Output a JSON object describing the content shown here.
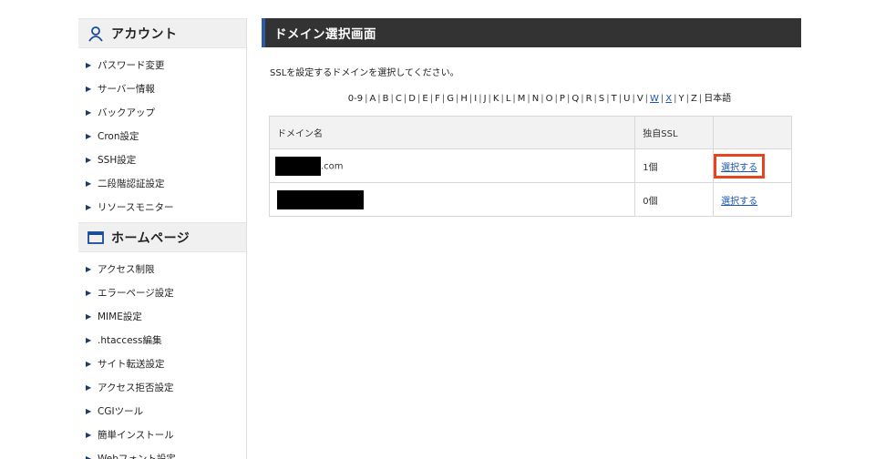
{
  "sidebar": {
    "sections": [
      {
        "title": "アカウント",
        "icon": "user-icon",
        "items": [
          "パスワード変更",
          "サーバー情報",
          "バックアップ",
          "Cron設定",
          "SSH設定",
          "二段階認証設定",
          "リソースモニター"
        ]
      },
      {
        "title": "ホームページ",
        "icon": "browser-window-icon",
        "items": [
          "アクセス制限",
          "エラーページ設定",
          "MIME設定",
          ".htaccess編集",
          "サイト転送設定",
          "アクセス拒否設定",
          "CGIツール",
          "簡単インストール",
          "Webフォント設定"
        ]
      }
    ]
  },
  "main": {
    "title": "ドメイン選択画面",
    "description": "SSLを設定するドメインを選択してください。",
    "alphabet": [
      "0-9",
      "A",
      "B",
      "C",
      "D",
      "E",
      "F",
      "G",
      "H",
      "I",
      "J",
      "K",
      "L",
      "M",
      "N",
      "O",
      "P",
      "Q",
      "R",
      "S",
      "T",
      "U",
      "V",
      "W",
      "X",
      "Y",
      "Z",
      "日本語"
    ],
    "alphabet_links": [
      "W",
      "X"
    ],
    "table": {
      "headers": [
        "ドメイン名",
        "独自SSL",
        ""
      ],
      "rows": [
        {
          "domain_suffix": ".com",
          "ssl": "1個",
          "action": "選択する",
          "highlighted": true
        },
        {
          "domain_suffix": "",
          "ssl": "0個",
          "action": "選択する",
          "highlighted": false
        }
      ]
    }
  },
  "colors": {
    "title_bar_bg": "#333333",
    "title_bar_accent": "#2a5aa8",
    "link": "#1a56b0",
    "highlight_border": "#e8431c"
  }
}
